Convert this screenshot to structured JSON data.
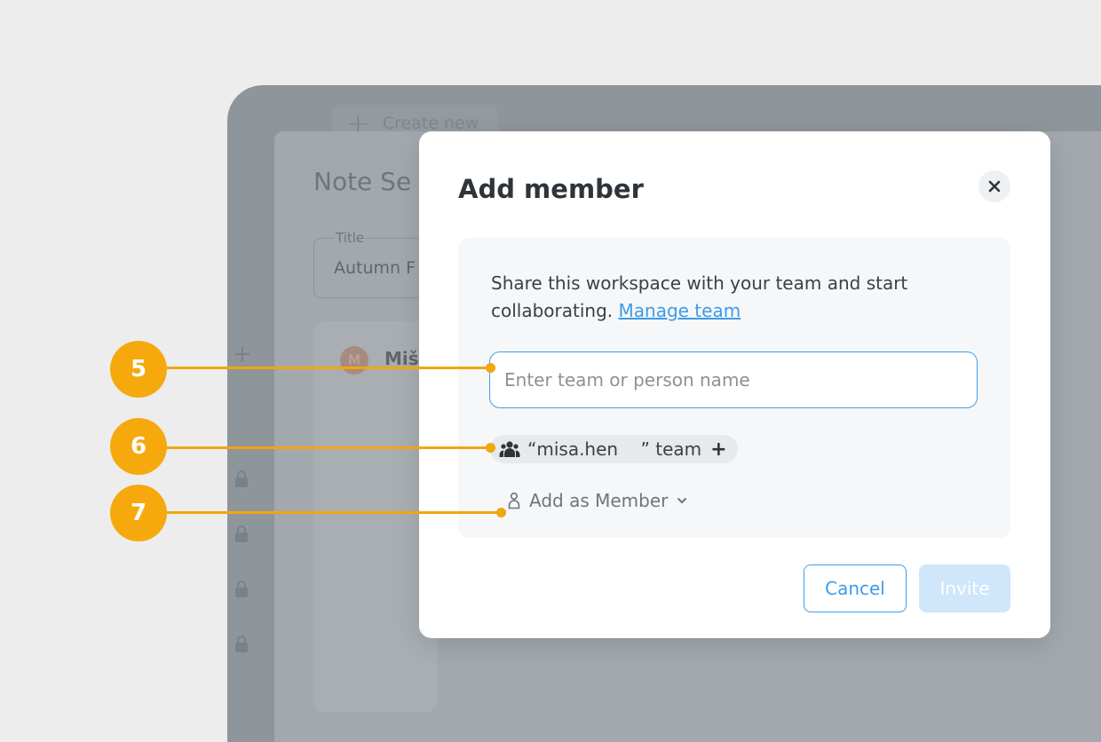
{
  "background_app": {
    "create_new_label": "Create new",
    "settings_title": "Note Se",
    "title_field_label": "Title",
    "title_field_value": "Autumn F",
    "member_avatar_letter": "M",
    "member_name": "Miš"
  },
  "modal": {
    "title": "Add member",
    "description": "Share this workspace with your team and start collaborating.",
    "manage_team_link": "Manage team",
    "search_placeholder": "Enter team or person name",
    "chip_label": "“misa.hen    ” team",
    "chip_add": "+",
    "role_label": "Add as Member",
    "cancel_label": "Cancel",
    "invite_label": "Invite"
  },
  "callouts": [
    "5",
    "6",
    "7"
  ],
  "colors": {
    "accent": "#3f9ee9",
    "callout": "#f6a90c",
    "invite_disabled": "#cfe6fb"
  },
  "icons": [
    "plus-icon",
    "lock-icon",
    "close-icon",
    "team-icon",
    "person-icon",
    "chevron-down-icon"
  ]
}
